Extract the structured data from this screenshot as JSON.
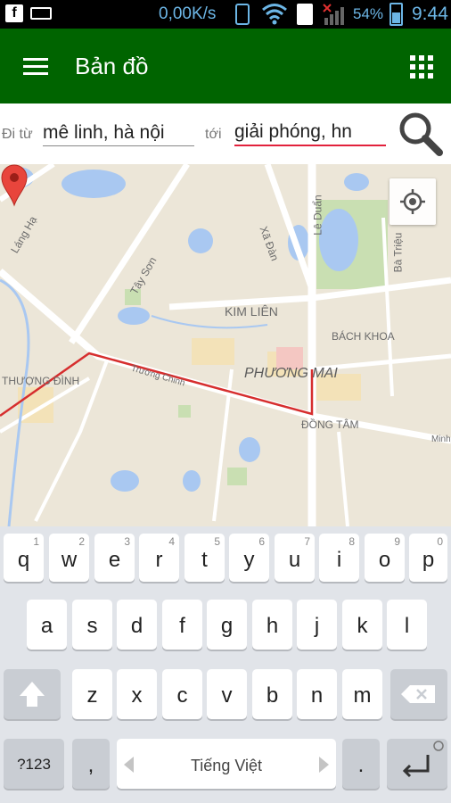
{
  "status_bar": {
    "network_speed": "0,00K/s",
    "battery_percent": "54%",
    "time": "9:44",
    "icons": [
      "facebook-icon",
      "keyboard-icon",
      "phone-icon",
      "wifi-icon",
      "sim-icon",
      "signal-icon",
      "battery-icon"
    ]
  },
  "app_bar": {
    "title": "Bản đồ",
    "color": "#006400",
    "icons": [
      "menu-icon",
      "grid-icon"
    ]
  },
  "route": {
    "from_label": "Đi từ",
    "from_value": "mê linh, hà nội",
    "to_label": "tới",
    "to_value": "giải phóng, hn",
    "search_icon": "search-icon",
    "accent": "#e2213c"
  },
  "map": {
    "labels": {
      "lang_ha": "Láng Hạ",
      "tay_son": "Tây Sơn",
      "xa_dan": "Xã Đàn",
      "le_duan": "Lê Duẩn",
      "ba_trieu": "Bà Triệu",
      "kim_lien": "KIM LIÊN",
      "bach_khoa": "BÁCH KHOA",
      "phuong_mai": "PHƯƠNG MAI",
      "truong_chinh": "Trường Chinh",
      "thuong_dinh": "THƯỢNG ĐÌNH",
      "dong_tam": "ĐỒNG TÂM",
      "minh": "Minh"
    },
    "route_color": "#d62e2e",
    "locate_icon": "my-location-icon",
    "pin_icon": "map-pin-icon"
  },
  "keyboard": {
    "row1": [
      {
        "ch": "q",
        "num": "1"
      },
      {
        "ch": "w",
        "num": "2"
      },
      {
        "ch": "e",
        "num": "3"
      },
      {
        "ch": "r",
        "num": "4"
      },
      {
        "ch": "t",
        "num": "5"
      },
      {
        "ch": "y",
        "num": "6"
      },
      {
        "ch": "u",
        "num": "7"
      },
      {
        "ch": "i",
        "num": "8"
      },
      {
        "ch": "o",
        "num": "9"
      },
      {
        "ch": "p",
        "num": "0"
      }
    ],
    "row2": [
      "a",
      "s",
      "d",
      "f",
      "g",
      "h",
      "j",
      "k",
      "l"
    ],
    "row3": [
      "z",
      "x",
      "c",
      "v",
      "b",
      "n",
      "m"
    ],
    "symbols_label": "?123",
    "comma_label": ",",
    "space_label": "Tiếng Việt",
    "period_label": ".",
    "icons": [
      "shift-icon",
      "backspace-icon",
      "enter-icon"
    ]
  }
}
